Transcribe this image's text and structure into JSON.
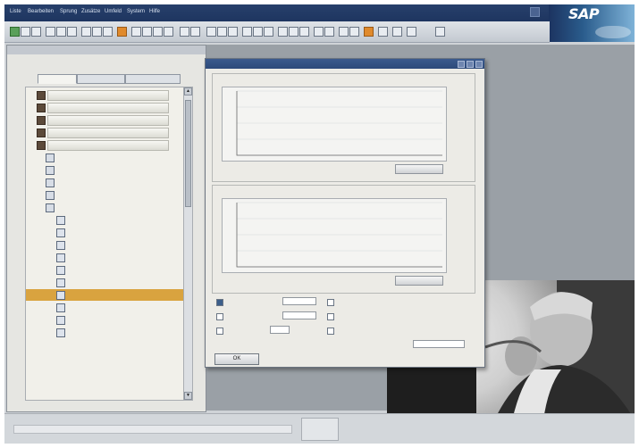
{
  "app": {
    "logo_text": "SAP"
  },
  "menubar": {
    "items": [
      "Liste",
      "Bearbeiten",
      "Sprung",
      "Zusätze",
      "Umfeld",
      "System",
      "Hilfe"
    ]
  },
  "left_panel": {
    "title": "",
    "info_lines": [
      "",
      ""
    ],
    "tabs": [
      "",
      "",
      ""
    ],
    "tree": [
      {
        "label": "",
        "level": 0
      },
      {
        "label": "",
        "level": 0
      },
      {
        "label": "",
        "level": 0
      },
      {
        "label": "",
        "level": 0
      },
      {
        "label": "",
        "level": 0
      },
      {
        "label": "",
        "level": 1
      },
      {
        "label": "",
        "level": 1
      },
      {
        "label": "",
        "level": 1
      },
      {
        "label": "",
        "level": 1
      },
      {
        "label": "",
        "level": 1
      },
      {
        "label": "",
        "level": 2
      },
      {
        "label": "",
        "level": 2
      },
      {
        "label": "",
        "level": 2
      },
      {
        "label": "",
        "level": 2
      },
      {
        "label": "",
        "level": 2
      },
      {
        "label": "",
        "level": 2
      },
      {
        "label": "",
        "level": 2,
        "selected": true
      },
      {
        "label": "",
        "level": 2
      },
      {
        "label": "",
        "level": 2
      },
      {
        "label": "",
        "level": 2
      }
    ]
  },
  "dialog": {
    "title": "",
    "ok_label": "OK",
    "group1": {
      "label": "",
      "caption": "",
      "button": ""
    },
    "group2": {
      "label": "",
      "caption": "",
      "button": ""
    },
    "options": {
      "left": [
        {
          "label": "",
          "checked": true
        },
        {
          "label": "",
          "checked": false
        },
        {
          "label": "",
          "checked": false
        }
      ],
      "right": [
        {
          "label": "",
          "checked": false
        },
        {
          "label": "",
          "checked": false
        },
        {
          "label": "",
          "checked": false
        }
      ],
      "field_value": "",
      "bottom_label": "",
      "bottom_field": ""
    }
  },
  "status": {
    "cells": [
      "",
      ""
    ]
  },
  "chart_data": [
    {
      "type": "line",
      "title": "",
      "series": [
        {
          "values": [
            0,
            0,
            0,
            0,
            0,
            0,
            0,
            0,
            0,
            0,
            0,
            0,
            0,
            0,
            0,
            0,
            0,
            0,
            0,
            0,
            0,
            0,
            0,
            0,
            0,
            0,
            0,
            0,
            0,
            0,
            0,
            0,
            0,
            0,
            0,
            0,
            0,
            0,
            0,
            0,
            0,
            0,
            0,
            0,
            0,
            0,
            0,
            0,
            0,
            0,
            0,
            0,
            0,
            0,
            0,
            0,
            0,
            0,
            0,
            0,
            0,
            0,
            0,
            0,
            0,
            0,
            0,
            0,
            0,
            0,
            0,
            0,
            0,
            0,
            0,
            0,
            0,
            0,
            0,
            0,
            0,
            0,
            0,
            0,
            0,
            0,
            0,
            0,
            0,
            0,
            0,
            0,
            0,
            0,
            0,
            0,
            0,
            0,
            0,
            0
          ]
        }
      ]
    },
    {
      "type": "line",
      "title": "",
      "series": [
        {
          "values": [
            0,
            0,
            0,
            0,
            0,
            0,
            0,
            0,
            0,
            0,
            0,
            0,
            0,
            0,
            0,
            0,
            0,
            0,
            0,
            0,
            0,
            0,
            0,
            0,
            0,
            0,
            0,
            0,
            0,
            0,
            0,
            0,
            0,
            0,
            0,
            0,
            0,
            0,
            0,
            0,
            0,
            0,
            0,
            0,
            0,
            0,
            0,
            0,
            0,
            0,
            0,
            0,
            0,
            0,
            0,
            0,
            0,
            0,
            0,
            0,
            0,
            0,
            0,
            0,
            0,
            0,
            0,
            0,
            0,
            0,
            0,
            0,
            0,
            0,
            0,
            0,
            0,
            0,
            0,
            0,
            0,
            0,
            0,
            0,
            0,
            0,
            0,
            0,
            0,
            0,
            0,
            0,
            0,
            0,
            0,
            0,
            0,
            0,
            0,
            0
          ]
        }
      ]
    }
  ]
}
